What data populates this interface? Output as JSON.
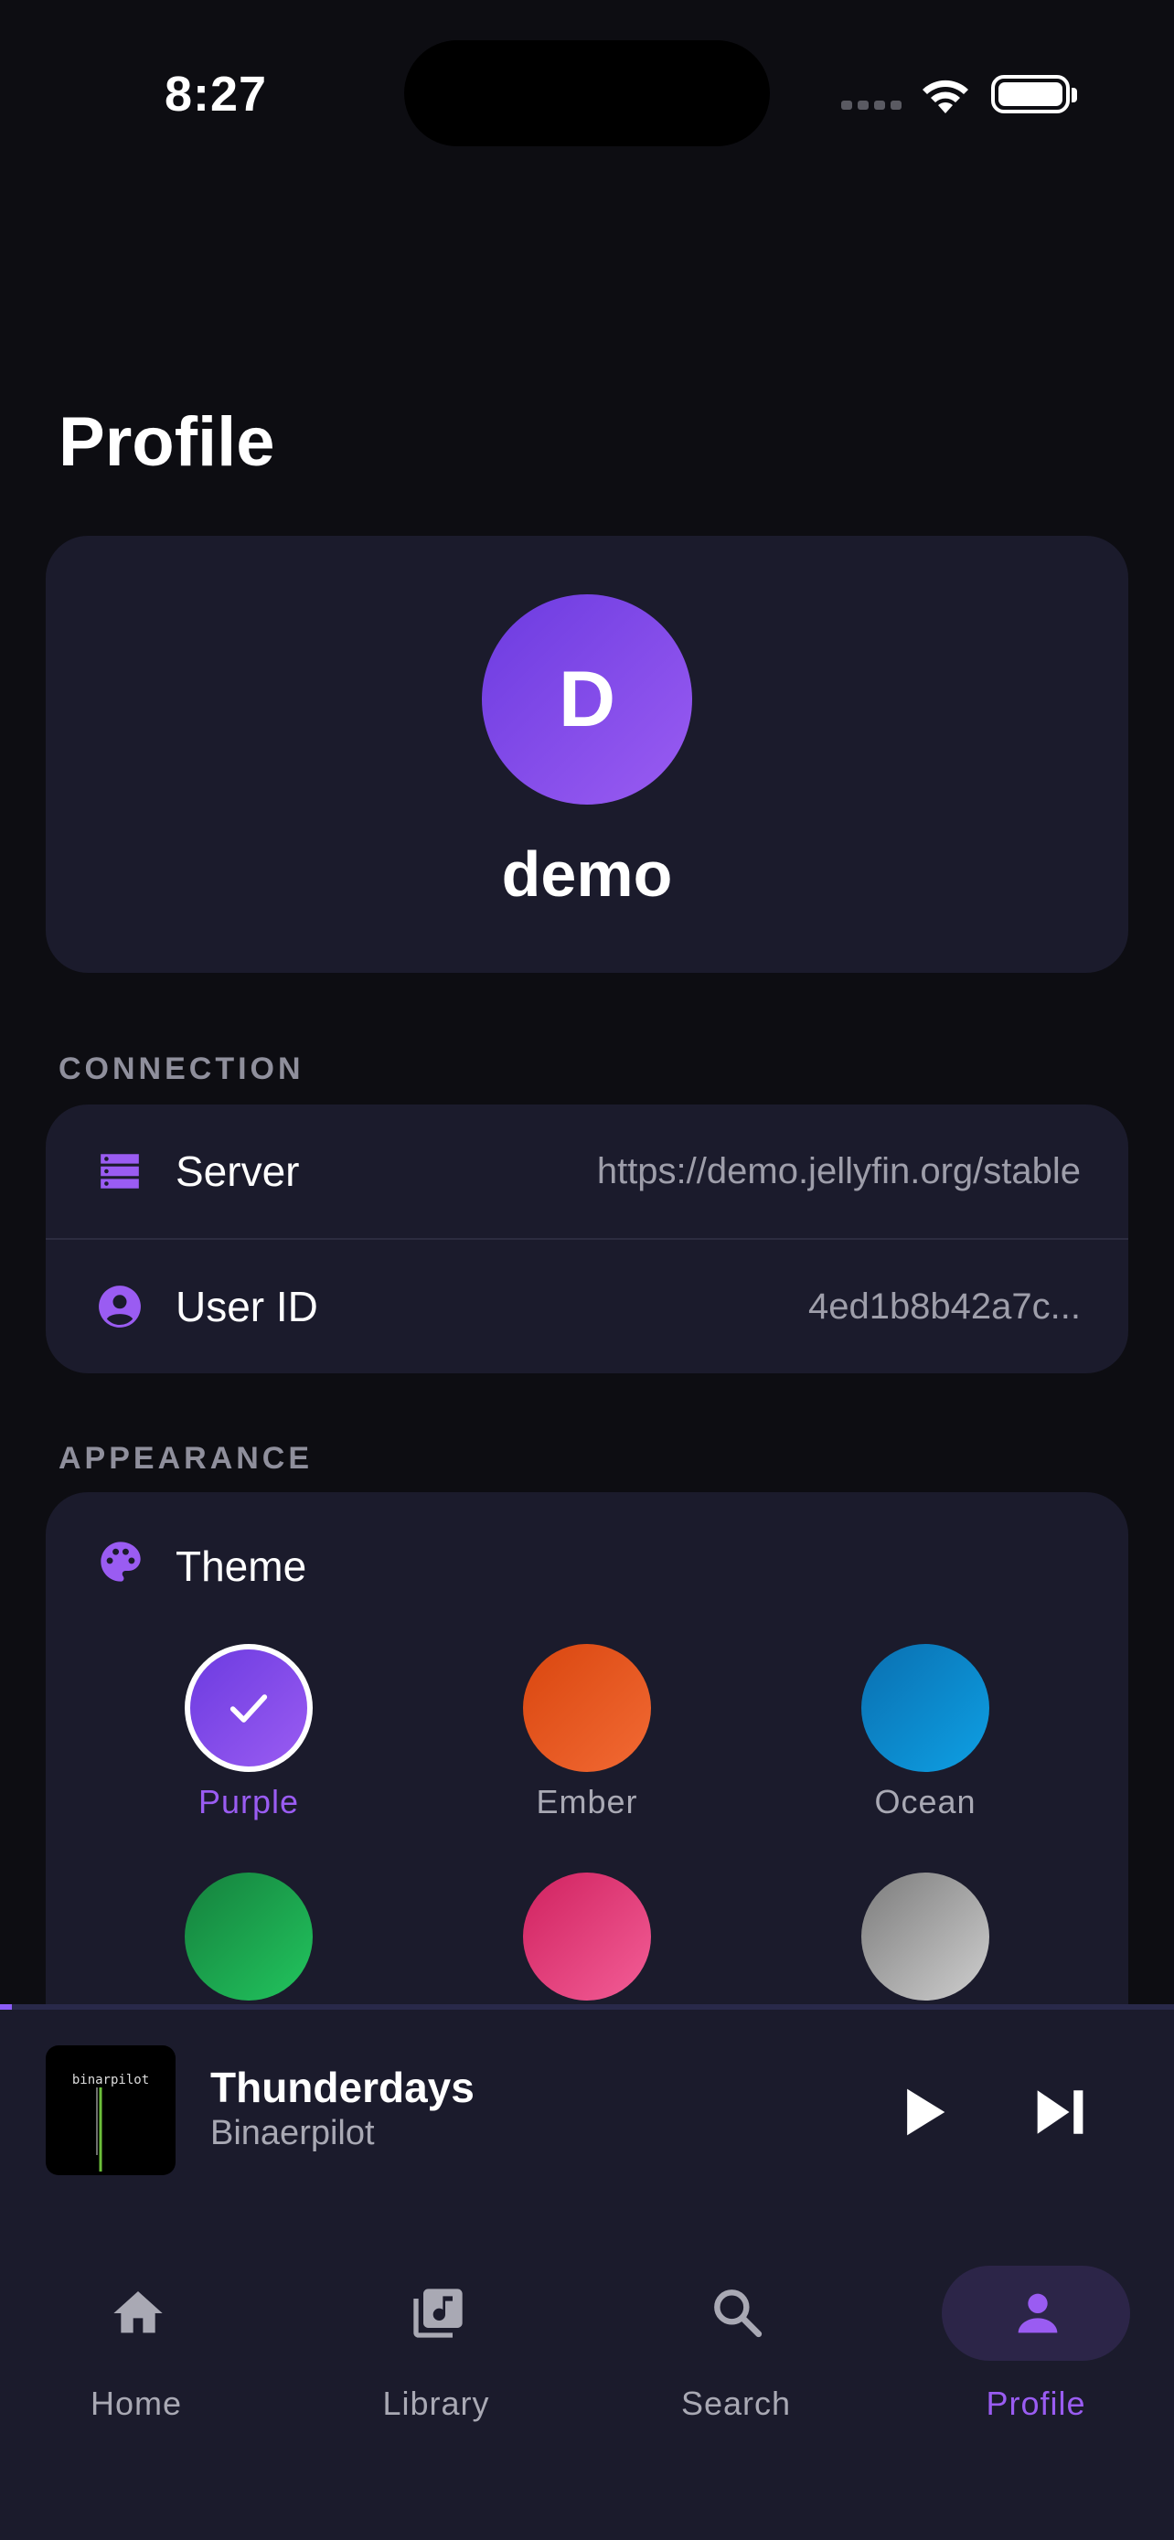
{
  "status_bar": {
    "time": "8:27"
  },
  "page_title": "Profile",
  "profile": {
    "initial": "D",
    "username": "demo"
  },
  "connection": {
    "section_label": "CONNECTION",
    "rows": [
      {
        "label": "Server",
        "value": "https://demo.jellyfin.org/stable",
        "icon": "server-icon"
      },
      {
        "label": "User ID",
        "value": "4ed1b8b42a7c...",
        "icon": "account-circle-icon"
      }
    ]
  },
  "appearance": {
    "section_label": "APPEARANCE",
    "theme_label": "Theme",
    "themes": [
      {
        "name": "Purple",
        "color_from": "#6c3be0",
        "color_to": "#9a5cf2",
        "selected": true
      },
      {
        "name": "Ember",
        "color_from": "#d9460f",
        "color_to": "#f26a34"
      },
      {
        "name": "Ocean",
        "color_from": "#0a6fb0",
        "color_to": "#0ea0e4"
      },
      {
        "color_from": "#15803d",
        "color_to": "#22c55e"
      },
      {
        "color_from": "#d0225f",
        "color_to": "#f35e97"
      },
      {
        "color_from": "#7c7c7c",
        "color_to": "#cfcfcf"
      }
    ]
  },
  "now_playing": {
    "title": "Thunderdays",
    "artist": "Binaerpilot",
    "album_text": "binarpilot",
    "progress": 0.01
  },
  "nav": {
    "items": [
      {
        "label": "Home",
        "icon": "home-icon"
      },
      {
        "label": "Library",
        "icon": "library-music-icon"
      },
      {
        "label": "Search",
        "icon": "search-icon"
      },
      {
        "label": "Profile",
        "icon": "person-icon",
        "active": true
      }
    ]
  },
  "colors": {
    "accent": "#9a5cf2",
    "card": "#1b1b2c",
    "background": "#0d0d12"
  }
}
